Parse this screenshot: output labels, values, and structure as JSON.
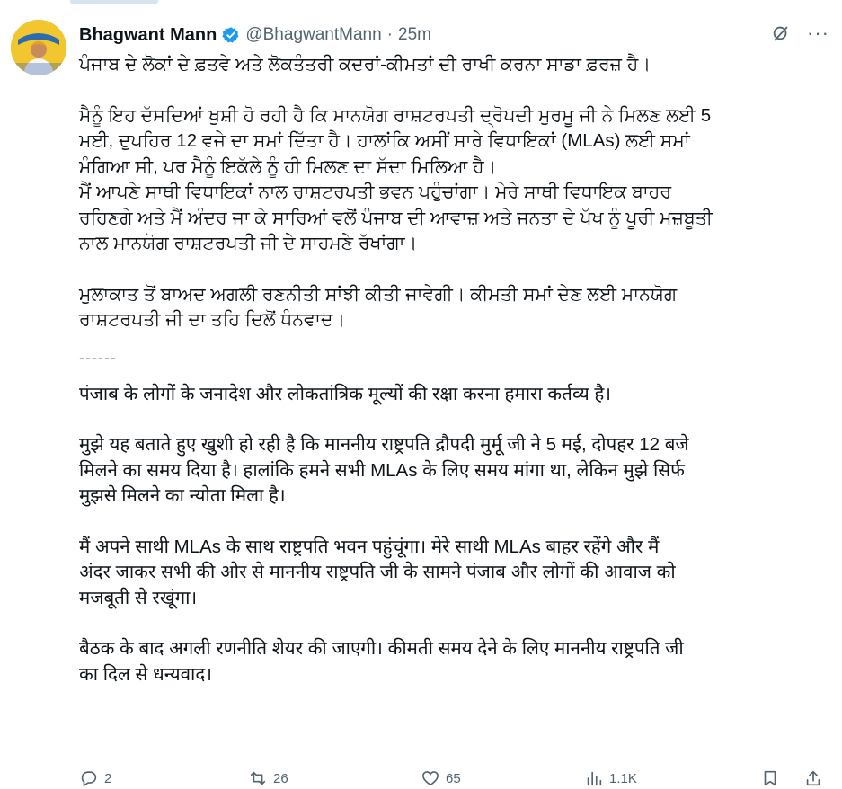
{
  "author": {
    "name": "Bhagwant Mann",
    "handle": "@BhagwantMann",
    "separator": "·",
    "time": "25m"
  },
  "tweet": {
    "paragraphs": [
      "ਪੰਜਾਬ ਦੇ ਲੋਕਾਂ ਦੇ ਫ਼ਤਵੇ ਅਤੇ ਲੋਕਤੰਤਰੀ ਕਦਰਾਂ-ਕੀਮਤਾਂ ਦੀ ਰਾਖੀ ਕਰਨਾ ਸਾਡਾ ਫ਼ਰਜ਼ ਹੈ।",
      "ਮੈਨੂੰ ਇਹ ਦੱਸਦਿਆਂ ਖੁਸ਼ੀ ਹੋ ਰਹੀ ਹੈ ਕਿ ਮਾਨਯੋਗ ਰਾਸ਼ਟਰਪਤੀ ਦ੍ਰੋਪਦੀ ਮੁਰਮੂ ਜੀ ਨੇ ਮਿਲਣ ਲਈ 5\nਮਈ, ਦੁਪਹਿਰ 12 ਵਜੇ ਦਾ ਸਮਾਂ ਦਿੱਤਾ ਹੈ। ਹਾਲਾਂਕਿ ਅਸੀਂ ਸਾਰੇ ਵਿਧਾਇਕਾਂ (MLAs) ਲਈ ਸਮਾਂ\nਮੰਗਿਆ ਸੀ, ਪਰ ਮੈਨੂੰ ਇਕੱਲੇ ਨੂੰ ਹੀ ਮਿਲਣ ਦਾ ਸੱਦਾ ਮਿਲਿਆ ਹੈ।\nਮੈਂ ਆਪਣੇ ਸਾਥੀ ਵਿਧਾਇਕਾਂ ਨਾਲ ਰਾਸ਼ਟਰਪਤੀ ਭਵਨ ਪਹੁੰਚਾਂਗਾ। ਮੇਰੇ ਸਾਥੀ ਵਿਧਾਇਕ ਬਾਹਰ\nਰਹਿਣਗੇ ਅਤੇ ਮੈਂ ਅੰਦਰ ਜਾ ਕੇ ਸਾਰਿਆਂ ਵਲੋਂ ਪੰਜਾਬ ਦੀ ਆਵਾਜ਼ ਅਤੇ ਜਨਤਾ ਦੇ ਪੱਖ ਨੂੰ ਪੂਰੀ ਮਜ਼ਬੂਤੀ\nਨਾਲ ਮਾਨਯੋਗ ਰਾਸ਼ਟਰਪਤੀ ਜੀ ਦੇ ਸਾਹਮਣੇ ਰੱਖਾਂਗਾ।",
      "ਮੁਲਾਕਾਤ ਤੋਂ ਬਾਅਦ ਅਗਲੀ ਰਣਨੀਤੀ ਸਾਂਝੀ ਕੀਤੀ ਜਾਵੇਗੀ। ਕੀਮਤੀ ਸਮਾਂ ਦੇਣ ਲਈ ਮਾਨਯੋਗ\nਰਾਸ਼ਟਰਪਤੀ ਜੀ ਦਾ ਤਹਿ ਦਿਲੋਂ ਧੰਨਵਾਦ।",
      "पंजाब के लोगों के जनादेश और लोकतांत्रिक मूल्यों की रक्षा करना हमारा कर्तव्य है।",
      "मुझे यह बताते हुए खुशी हो रही है कि माननीय राष्ट्रपति द्रौपदी मुर्मू जी ने 5 मई, दोपहर 12 बजे\nमिलने का समय दिया है। हालांकि हमने सभी MLAs के लिए समय मांगा था, लेकिन मुझे सिर्फ\nमुझसे मिलने का न्योता मिला है।",
      "मैं अपने साथी MLAs के साथ राष्ट्रपति भवन पहुंचूंगा। मेरे साथी MLAs बाहर रहेंगे और मैं\nअंदर जाकर सभी की ओर से माननीय राष्ट्रपति जी के सामने पंजाब और लोगों की आवाज को\nमजबूती से रखूंगा।",
      "बैठक के बाद अगली रणनीति शेयर की जाएगी। कीमती समय देने के लिए माननीय राष्ट्रपति जी\nका दिल से धन्यवाद।"
    ],
    "divider": "------"
  },
  "actions": {
    "replies": "2",
    "retweets": "26",
    "likes": "65",
    "views": "1.1K"
  },
  "colors": {
    "text": "#0f1419",
    "secondary": "#536471",
    "verified": "#1d9bf0"
  }
}
